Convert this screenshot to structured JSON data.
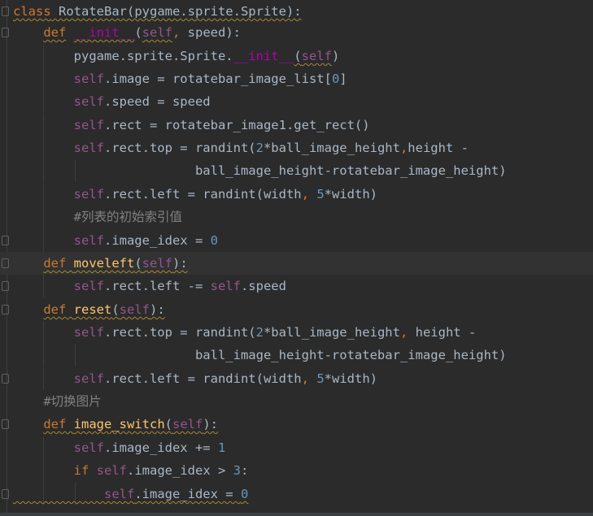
{
  "editor": {
    "lines": [
      {
        "segs": [
          [
            "kw",
            "class"
          ],
          [
            "t",
            " RotateBar(pygame.sprite.Sprite):"
          ]
        ]
      },
      {
        "segs": [
          [
            "t",
            "    "
          ],
          [
            "kw",
            "def"
          ],
          [
            "t",
            " "
          ],
          [
            "magic",
            "__init__"
          ],
          [
            "t",
            "("
          ],
          [
            "self",
            "self"
          ],
          [
            "kw",
            ","
          ],
          [
            "t",
            " speed):"
          ]
        ]
      },
      {
        "segs": [
          [
            "t",
            "        pygame.sprite.Sprite."
          ],
          [
            "magic",
            "__init__"
          ],
          [
            "t",
            "("
          ],
          [
            "self",
            "self"
          ],
          [
            "t",
            ")"
          ]
        ]
      },
      {
        "segs": [
          [
            "t",
            "        "
          ],
          [
            "self",
            "self"
          ],
          [
            "t",
            ".image = rotatebar_image_list["
          ],
          [
            "num",
            "0"
          ],
          [
            "t",
            "]"
          ]
        ]
      },
      {
        "segs": [
          [
            "t",
            "        "
          ],
          [
            "self",
            "self"
          ],
          [
            "t",
            ".speed = speed"
          ]
        ]
      },
      {
        "segs": [
          [
            "t",
            "        "
          ],
          [
            "self",
            "self"
          ],
          [
            "t",
            ".rect = rotatebar_image1.get_rect()"
          ]
        ]
      },
      {
        "segs": [
          [
            "t",
            "        "
          ],
          [
            "self",
            "self"
          ],
          [
            "t",
            ".rect.top = randint("
          ],
          [
            "num",
            "2"
          ],
          [
            "t",
            "*ball_image_height"
          ],
          [
            "kw",
            ","
          ],
          [
            "t",
            "height -"
          ]
        ]
      },
      {
        "segs": [
          [
            "t",
            "                        ball_image_height-rotatebar_image_height)"
          ]
        ]
      },
      {
        "segs": [
          [
            "t",
            "        "
          ],
          [
            "self",
            "self"
          ],
          [
            "t",
            ".rect.left = randint(width"
          ],
          [
            "kw",
            ","
          ],
          [
            "t",
            " "
          ],
          [
            "num",
            "5"
          ],
          [
            "t",
            "*width)"
          ]
        ]
      },
      {
        "segs": [
          [
            "t",
            "        "
          ],
          [
            "cm",
            "#列表的初始索引值"
          ]
        ]
      },
      {
        "segs": [
          [
            "t",
            "        "
          ],
          [
            "self",
            "self"
          ],
          [
            "t",
            ".image_idex = "
          ],
          [
            "num",
            "0"
          ]
        ]
      },
      {
        "segs": [
          [
            "t",
            "    "
          ],
          [
            "kw",
            "def"
          ],
          [
            "t",
            " "
          ],
          [
            "fn",
            "moveleft"
          ],
          [
            "t",
            "("
          ],
          [
            "self",
            "self"
          ],
          [
            "t",
            "):"
          ]
        ]
      },
      {
        "segs": [
          [
            "t",
            "        "
          ],
          [
            "self",
            "self"
          ],
          [
            "t",
            ".rect.left -= "
          ],
          [
            "self",
            "self"
          ],
          [
            "t",
            ".speed"
          ]
        ]
      },
      {
        "segs": [
          [
            "t",
            "    "
          ],
          [
            "kw",
            "def"
          ],
          [
            "t",
            " "
          ],
          [
            "fn",
            "reset"
          ],
          [
            "t",
            "("
          ],
          [
            "self",
            "self"
          ],
          [
            "t",
            "):"
          ]
        ]
      },
      {
        "segs": [
          [
            "t",
            "        "
          ],
          [
            "self",
            "self"
          ],
          [
            "t",
            ".rect.top = randint("
          ],
          [
            "num",
            "2"
          ],
          [
            "t",
            "*ball_image_height"
          ],
          [
            "kw",
            ","
          ],
          [
            "t",
            " height -"
          ]
        ]
      },
      {
        "segs": [
          [
            "t",
            "                        ball_image_height-rotatebar_image_height)"
          ]
        ]
      },
      {
        "segs": [
          [
            "t",
            "        "
          ],
          [
            "self",
            "self"
          ],
          [
            "t",
            ".rect.left = randint(width"
          ],
          [
            "kw",
            ","
          ],
          [
            "t",
            " "
          ],
          [
            "num",
            "5"
          ],
          [
            "t",
            "*width)"
          ]
        ]
      },
      {
        "segs": [
          [
            "t",
            "    "
          ],
          [
            "cm",
            "#切换图片"
          ]
        ]
      },
      {
        "segs": [
          [
            "t",
            "    "
          ],
          [
            "kw",
            "def"
          ],
          [
            "t",
            " "
          ],
          [
            "fn",
            "image_switch"
          ],
          [
            "t",
            "("
          ],
          [
            "self",
            "self"
          ],
          [
            "t",
            "):"
          ]
        ]
      },
      {
        "segs": [
          [
            "t",
            "        "
          ],
          [
            "self",
            "self"
          ],
          [
            "t",
            ".image_idex += "
          ],
          [
            "num",
            "1"
          ]
        ]
      },
      {
        "segs": [
          [
            "t",
            "        "
          ],
          [
            "kw",
            "if"
          ],
          [
            "t",
            " "
          ],
          [
            "self",
            "self"
          ],
          [
            "t",
            ".image_idex > "
          ],
          [
            "num",
            "3"
          ],
          [
            "t",
            ":"
          ]
        ]
      },
      {
        "segs": [
          [
            "t",
            "            "
          ],
          [
            "self",
            "self"
          ],
          [
            "t",
            ".image_idex = "
          ],
          [
            "num",
            "0"
          ]
        ]
      }
    ]
  }
}
